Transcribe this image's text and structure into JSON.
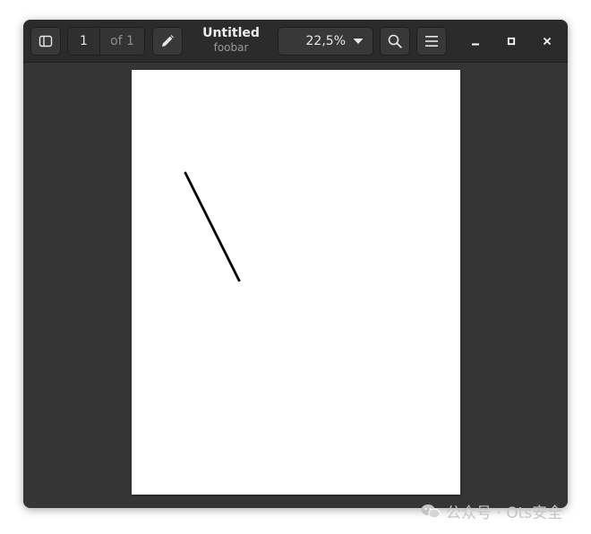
{
  "headerbar": {
    "sidebar_icon": "sidebar-toggle-icon",
    "page_number": "1",
    "page_of": "of 1",
    "edit_icon": "pencil-icon",
    "title": "Untitled",
    "subtitle": "foobar",
    "zoom": "22,5%",
    "zoom_icon": "chevron-down-icon",
    "search_icon": "search-icon",
    "menu_icon": "hamburger-menu-icon",
    "window_controls": [
      "minimize-icon",
      "maximize-icon",
      "close-icon"
    ]
  },
  "document": {
    "background": "#ffffff",
    "stroke_color": "#000000"
  },
  "watermark": {
    "text": "公众号 · Ots安全",
    "logo_icon": "wechat-icon"
  },
  "colors": {
    "window_bg": "#353535",
    "headerbar_bg": "#2b2b2b",
    "text_primary": "#eeeeee",
    "text_dim": "#9a9a9a"
  }
}
